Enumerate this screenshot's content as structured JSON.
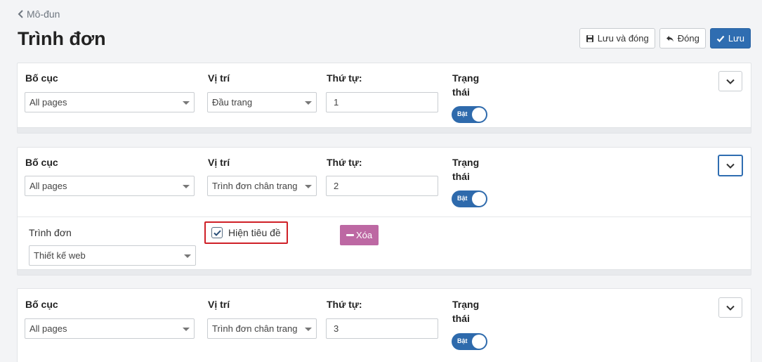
{
  "nav": {
    "back_label": "Mô-đun"
  },
  "page": {
    "title": "Trình đơn"
  },
  "toolbar": {
    "save_close_label": "Lưu và đóng",
    "close_label": "Đóng",
    "save_label": "Lưu"
  },
  "field_labels": {
    "layout": "Bố cục",
    "position": "Vị trí",
    "order": "Thứ tự:",
    "status_line1": "Trạng",
    "status_line2": "thái"
  },
  "rows": [
    {
      "layout": "All pages",
      "position": "Đầu trang",
      "order": "1",
      "status": "Bật"
    },
    {
      "layout": "All pages",
      "position": "Trình đơn chân trang",
      "order": "2",
      "status": "Bật"
    },
    {
      "layout": "All pages",
      "position": "Trình đơn chân trang",
      "order": "3",
      "status": "Bật"
    }
  ],
  "details": {
    "menu_label": "Trình đơn",
    "menu_value": "Thiết kế web",
    "show_title_label": "Hiện tiêu đề",
    "show_title_checked": true,
    "delete_label": "Xóa"
  },
  "colors": {
    "primary": "#2f6db1",
    "delete": "#bd68a3",
    "highlight": "#cf2027"
  }
}
